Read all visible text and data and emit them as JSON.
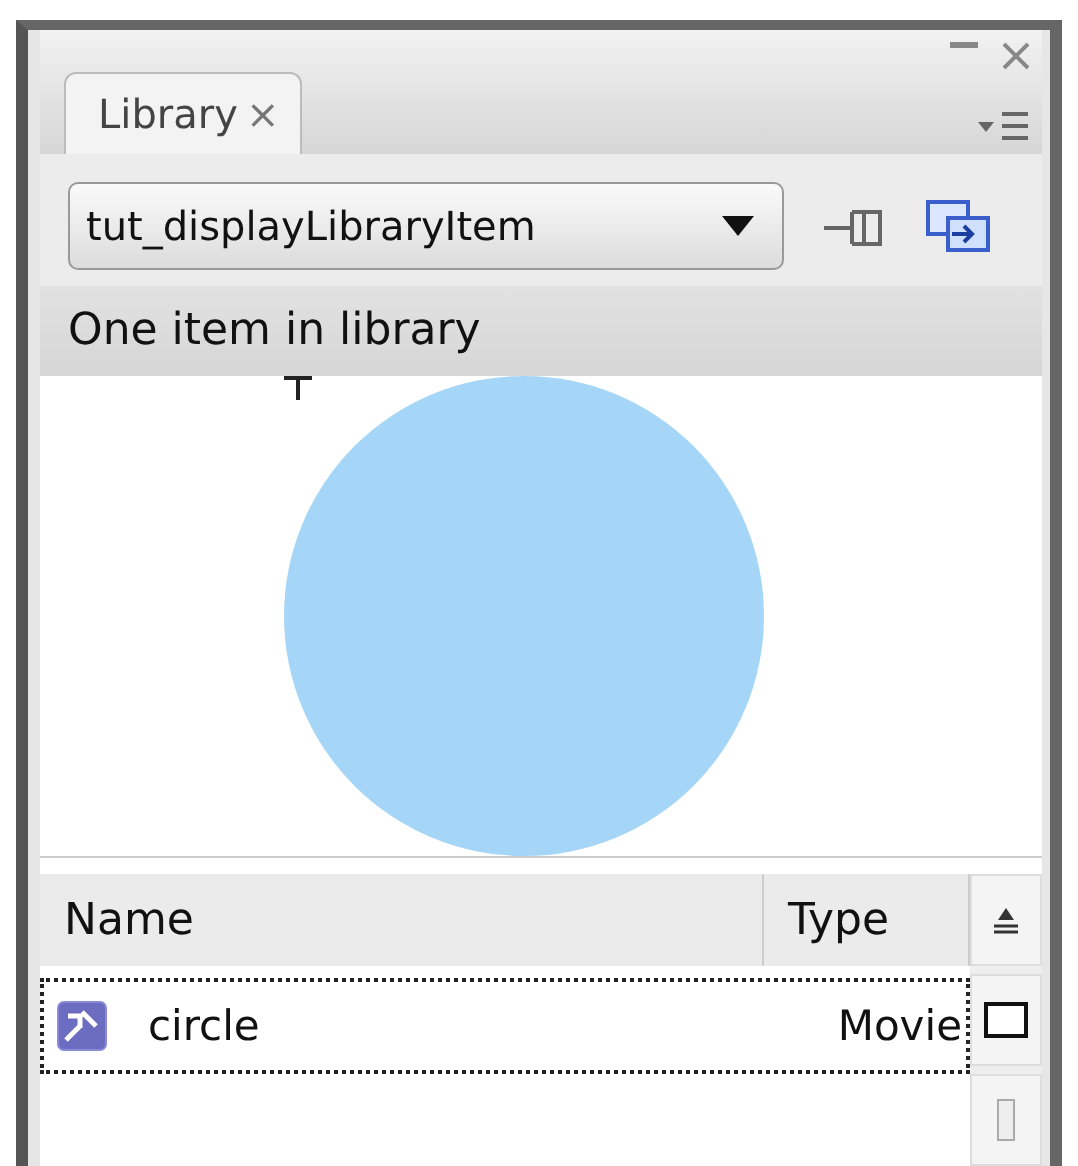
{
  "tabs": [
    {
      "label": "Library",
      "selected": true
    }
  ],
  "close_glyph": "×",
  "library_select": {
    "value": "tut_displayLibraryItem"
  },
  "item_count": "One item in library",
  "preview": {
    "kind": "circle"
  },
  "table": {
    "columns": [
      "Name",
      "Type"
    ],
    "rows": [
      {
        "name": "circle",
        "type": "Movie",
        "selected": true
      }
    ]
  }
}
